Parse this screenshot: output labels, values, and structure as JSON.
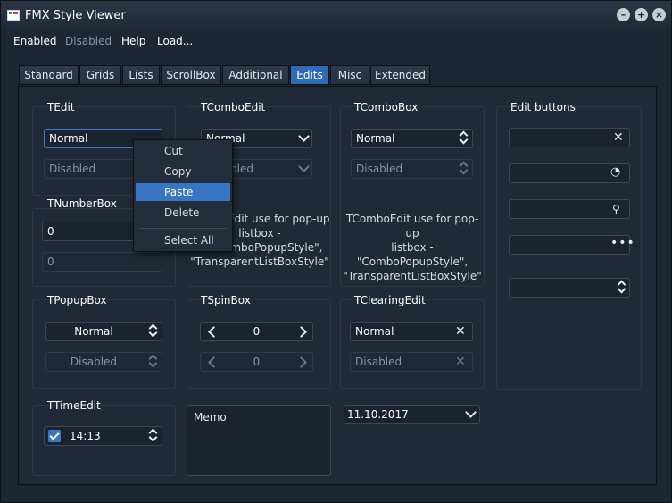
{
  "window": {
    "title": "FMX Style Viewer"
  },
  "menu": [
    "Enabled",
    "Disabled",
    "Help",
    "Load..."
  ],
  "tabs": [
    "Standard",
    "Grids",
    "Lists",
    "ScrollBox",
    "Additional",
    "Edits",
    "Misc",
    "Extended"
  ],
  "active_tab": "Edits",
  "tedit": {
    "title": "TEdit",
    "normal": "Normal",
    "disabled": "Disabled"
  },
  "context_menu": {
    "items": [
      "Cut",
      "Copy",
      "Paste",
      "Delete",
      "Select All"
    ],
    "selected": "Paste"
  },
  "tcomboedit": {
    "title": "TComboEdit",
    "normal": "Normal",
    "disabled": "bled",
    "desc": [
      "Edit use for pop-up",
      "listbox -",
      "omboPopupStyle\",",
      "\"TransparentListBoxStyle\""
    ]
  },
  "tcombobox": {
    "title": "TComboBox",
    "normal": "Normal",
    "disabled": "Disabled",
    "desc": [
      "TComboEdit use for pop-up",
      "listbox -",
      "\"ComboPopupStyle\",",
      "\"TransparentListBoxStyle\""
    ]
  },
  "edit_buttons": {
    "title": "Edit buttons"
  },
  "tnumberbox": {
    "title": "TNumberBox",
    "normal": "0",
    "disabled": "0"
  },
  "tpopupbox": {
    "title": "TPopupBox",
    "normal": "Normal",
    "disabled": "Disabled"
  },
  "tspinbox": {
    "title": "TSpinBox",
    "normal": "0",
    "disabled": "0"
  },
  "tclearingedit": {
    "title": "TClearingEdit",
    "normal": "Normal",
    "disabled": "Disabled"
  },
  "ttimeedit": {
    "title": "TTimeEdit",
    "value": "14:13",
    "checked": true
  },
  "memo": {
    "text": "Memo"
  },
  "dateedit": {
    "value": "11.10.2017"
  },
  "icons": [
    "close-icon",
    "minimize-icon",
    "maximize-icon",
    "clear-icon",
    "password-eye-icon",
    "search-icon",
    "ellipsis-icon",
    "updown-icon",
    "chevron-down-icon"
  ],
  "colors": {
    "accent": "#2e6cb5",
    "selection": "#3875c2",
    "background": "#1f2937"
  }
}
